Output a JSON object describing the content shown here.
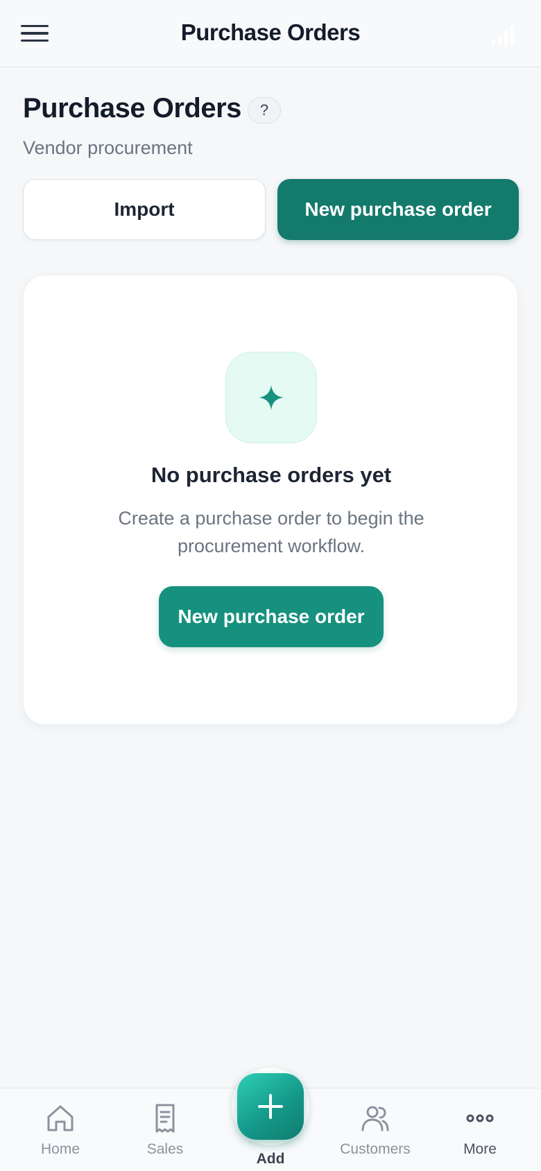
{
  "topbar": {
    "title": "Purchase Orders",
    "menu_icon": "hamburger-menu-icon",
    "signal_icon": "signal-bars-icon"
  },
  "header": {
    "title": "Purchase Orders",
    "help_label": "?",
    "subtitle": "Vendor procurement"
  },
  "actions": {
    "import_label": "Import",
    "new_label": "New purchase order"
  },
  "empty_state": {
    "icon": "sparkle-icon",
    "title": "No purchase orders yet",
    "description": "Create a purchase order to begin the procurement workflow.",
    "button_label": "New purchase order"
  },
  "bottom_nav": {
    "items": [
      {
        "label": "Home",
        "icon": "home-icon"
      },
      {
        "label": "Sales",
        "icon": "receipt-icon"
      },
      {
        "label": "Add",
        "icon": "plus-icon"
      },
      {
        "label": "Customers",
        "icon": "users-icon"
      },
      {
        "label": "More",
        "icon": "more-dots-icon"
      }
    ]
  },
  "colors": {
    "primary": "#147a6c",
    "primary_light": "#16917f",
    "accent_bg": "#e4faf3",
    "text_dark": "#141b29",
    "text_muted": "#6b7480",
    "nav_inactive": "#8a929c"
  }
}
